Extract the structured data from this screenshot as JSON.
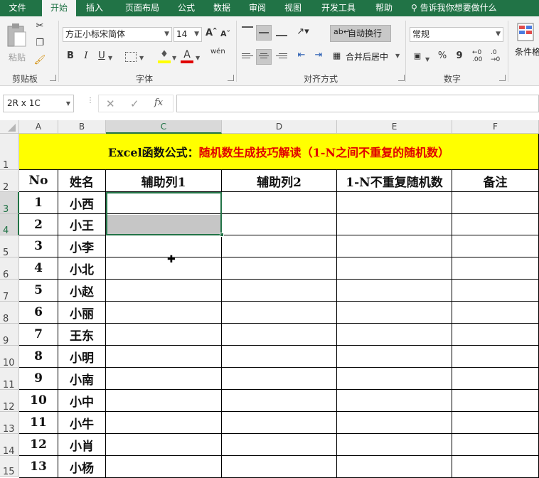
{
  "ribbon_tabs": [
    "文件",
    "开始",
    "插入",
    "页面布局",
    "公式",
    "数据",
    "审阅",
    "视图",
    "开发工具",
    "帮助"
  ],
  "active_tab": "开始",
  "tell_me": "告诉我你想要做什么",
  "clipboard": {
    "paste_label": "粘贴",
    "group_label": "剪贴板"
  },
  "font": {
    "name": "方正小标宋简体",
    "size": "14",
    "group_label": "字体",
    "bold": "B",
    "italic": "I",
    "underline": "U",
    "color_letter": "A",
    "phonetic": "wén"
  },
  "alignment": {
    "wrap_text": "自动换行",
    "merge_center": "合并后居中",
    "group_label": "对齐方式"
  },
  "number": {
    "format": "常规",
    "group_label": "数字",
    "percent": "%",
    "comma": "9",
    "inc_dec": ".00",
    "dec_dec": ".0"
  },
  "styles": {
    "conditional_format": "条件格式"
  },
  "name_box": "2R x 1C",
  "fx_label": "fx",
  "columns": [
    "A",
    "B",
    "C",
    "D",
    "E",
    "F"
  ],
  "selected_column": "C",
  "rows": [
    "1",
    "2",
    "3",
    "4",
    "5",
    "6",
    "7",
    "8",
    "9",
    "10",
    "11",
    "12",
    "13",
    "14",
    "15"
  ],
  "title_black": "Excel函数公式：",
  "title_red": "随机数生成技巧解读（1-N之间不重复的随机数）",
  "headers": [
    "No",
    "姓名",
    "辅助列1",
    "辅助列2",
    "1-N不重复随机数",
    "备注"
  ],
  "data_rows": [
    [
      "1",
      "小西"
    ],
    [
      "2",
      "小王"
    ],
    [
      "3",
      "小李"
    ],
    [
      "4",
      "小北"
    ],
    [
      "5",
      "小赵"
    ],
    [
      "6",
      "小丽"
    ],
    [
      "7",
      "王东"
    ],
    [
      "8",
      "小明"
    ],
    [
      "9",
      "小南"
    ],
    [
      "10",
      "小中"
    ],
    [
      "11",
      "小牛"
    ],
    [
      "12",
      "小肖"
    ],
    [
      "13",
      "小杨"
    ]
  ],
  "colors": {
    "excel_green": "#217346",
    "title_fill": "#ffff00",
    "title_red": "#e00000",
    "selection_gray": "#c6c6c6"
  }
}
